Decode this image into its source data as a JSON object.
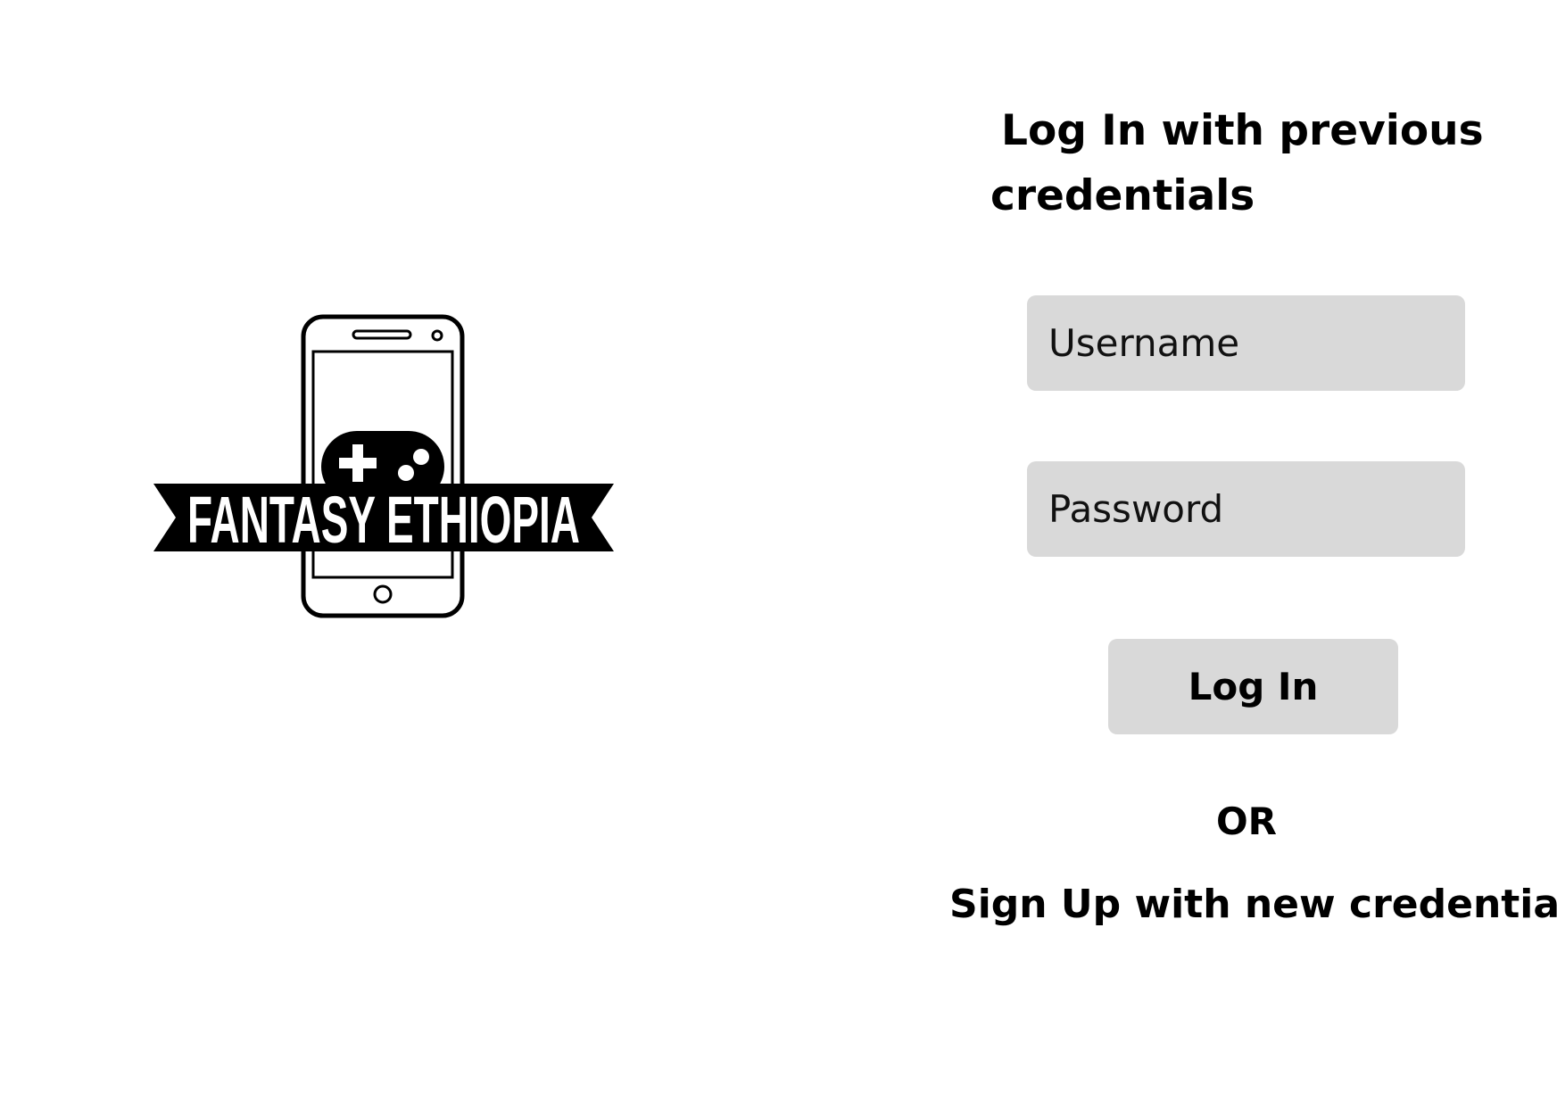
{
  "logo": {
    "text": "FANTASY ETHIOPIA",
    "icon": "phone-gamepad-logo",
    "banner_color": "#000000",
    "banner_text_color": "#ffffff"
  },
  "login": {
    "heading_line1": "Log In with previous",
    "heading_line2": "credentials",
    "username_placeholder": "Username",
    "password_placeholder": "Password",
    "login_button_label": "Log In",
    "field_color": "#d9d9d9"
  },
  "divider": {
    "or_label": "OR"
  },
  "signup": {
    "link_label": "Sign Up with new credentials"
  }
}
